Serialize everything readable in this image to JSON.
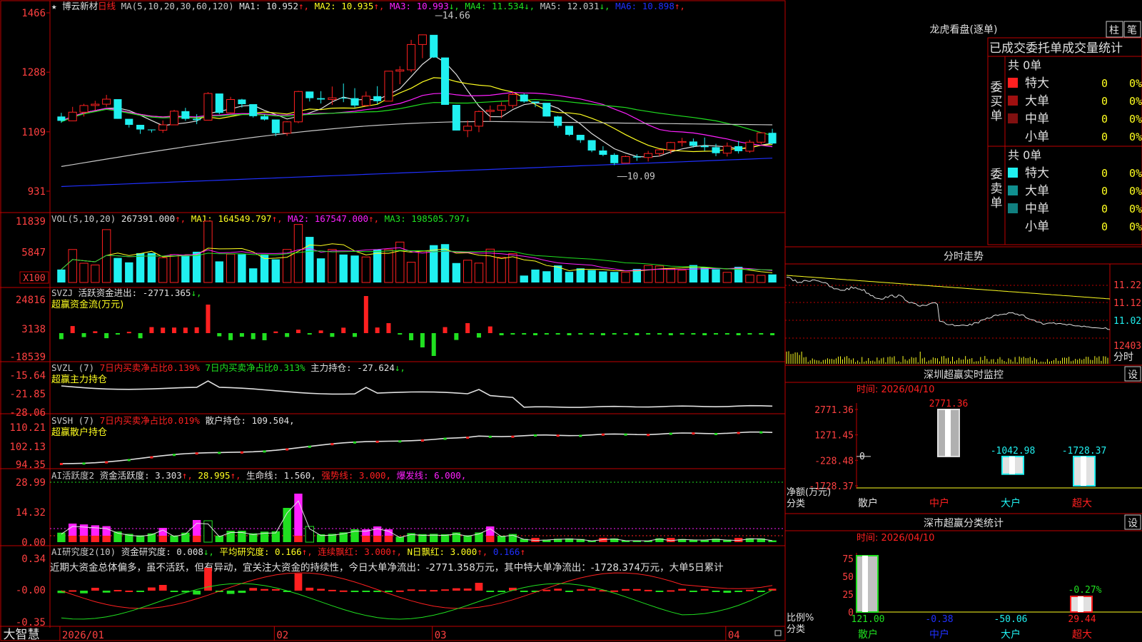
{
  "colors": {
    "up": "#ff2020",
    "down": "#20f0f0",
    "green": "#20e020",
    "magenta": "#ff20ff",
    "yellow": "#ffff20",
    "white": "#e0e0e0",
    "blue": "#2030ff",
    "grid": "#c00000",
    "axis_text": "#ff4040",
    "label": "#c8c8c8"
  },
  "header": {
    "star": "★",
    "stock_name": "博云新材",
    "period": "日线",
    "ma_spec": "MA(5,10,20,30,60,120)",
    "ma_items": [
      {
        "label": "MA1: 10.952",
        "arrow": "↑",
        "color": "#e0e0e0"
      },
      {
        "label": "MA2: 10.935",
        "arrow": "↑",
        "color": "#ffff20"
      },
      {
        "label": "MA3: 10.993",
        "arrow": "↓",
        "color": "#ff20ff"
      },
      {
        "label": "MA4: 11.534",
        "arrow": "↓",
        "color": "#20e020"
      },
      {
        "label": "MA5: 12.031",
        "arrow": "↓",
        "color": "#c8c8c8"
      },
      {
        "label": "MA6: 10.898",
        "arrow": "↑",
        "color": "#2030ff"
      }
    ]
  },
  "main_axis": {
    "ticks": [
      "1466",
      "1288",
      "1109",
      "931"
    ]
  },
  "annotations": {
    "high": "14.66",
    "low": "10.09"
  },
  "vol_panel": {
    "title": "VOL(5,10,20)",
    "value": "267391.000",
    "ma1": "MA1: 164549.797",
    "ma2": "MA2: 167547.000",
    "ma3": "MA3: 198505.797",
    "ticks": [
      "11839",
      "5847"
    ],
    "unit": "X100"
  },
  "svzj_panel": {
    "title": "SVZJ",
    "item": "活跃资金进出: -2771.365",
    "subtitle": "超赢资金流(万元)",
    "ticks": [
      "24816",
      "3138",
      "-18539"
    ]
  },
  "svzl_panel": {
    "title": "SVZL (7)",
    "item1": "7日内买卖净占比0.139%",
    "item2": "7日内买卖净占比0.313%",
    "item3": "主力持仓: -27.624",
    "subtitle": "超赢主力持仓",
    "ticks": [
      "-15.64",
      "-21.85",
      "-28.06"
    ]
  },
  "svsh_panel": {
    "title": "SVSH (7)",
    "item1": "7日内买卖净占比0.019%",
    "item2": "散户持仓: 109.504,",
    "subtitle": "超赢散户持仓",
    "ticks": [
      "110.21",
      "102.13",
      "94.35"
    ]
  },
  "ai_active_panel": {
    "title": "AI活跃度2",
    "item1": "资金活跃度: 3.303",
    "item2": "28.995",
    "item3": "生命线: 1.560,",
    "item4": "强势线: 3.000,",
    "item5": "爆发线: 6.000,",
    "ticks": [
      "28.99",
      "14.32",
      "0.00"
    ]
  },
  "ai_research_panel": {
    "title": "AI研究度2(10)",
    "item1": "资金研究度: 0.008",
    "item2": "平均研究度: 0.166",
    "item3": "连续飘红: 3.000",
    "item4": "N日飘红: 3.000",
    "item5": "0.166",
    "commentary": "近期大资金总体偏多，虽不活跃，但有异动，宜关注大资金的持续性，今日大单净流出：-2771.358万元，其中特大单净流出：-1728.374万元，大单5日累计",
    "ticks": [
      "0.34",
      "-0.00",
      "-0.35"
    ]
  },
  "date_axis": {
    "labels": [
      "2026/01",
      "02",
      "03",
      "04"
    ]
  },
  "brand": "大智慧",
  "right_panel": {
    "dragon_title": "龙虎看盘(逐单)",
    "tabs": [
      "柱",
      "笔"
    ],
    "table_title": "已成交委托单成交量统计",
    "buy_header": "共 0单",
    "buy_label": "委买单",
    "buy_rows": [
      {
        "name": "特大",
        "count": "0",
        "pct": "0%",
        "color": "#ff2020"
      },
      {
        "name": "大单",
        "count": "0",
        "pct": "0%",
        "color": "#a01010"
      },
      {
        "name": "中单",
        "count": "0",
        "pct": "0%",
        "color": "#801010"
      },
      {
        "name": "小单",
        "count": "0",
        "pct": "0%",
        "color": "#000000"
      }
    ],
    "sell_header": "共 0单",
    "sell_label": "委卖单",
    "sell_rows": [
      {
        "name": "特大",
        "count": "0",
        "pct": "0%",
        "color": "#20f0f0"
      },
      {
        "name": "大单",
        "count": "0",
        "pct": "0%",
        "color": "#108f8f"
      },
      {
        "name": "中单",
        "count": "0",
        "pct": "0%",
        "color": "#107f7f"
      },
      {
        "name": "小单",
        "count": "0",
        "pct": "0%",
        "color": "#000000"
      }
    ],
    "intraday_title": "分时走势",
    "intraday_ticks": [
      "11.22",
      "11.12",
      "11.02",
      "12403"
    ],
    "intraday_label": "分时",
    "monitor_title": "深圳超赢实时监控",
    "monitor_setting": "设",
    "monitor_time": "时间: 2026/04/10",
    "monitor_ticks": [
      "2771.36",
      "1271.45",
      "-228.48",
      "-1728.37"
    ],
    "monitor_zero": "0",
    "monitor_net_label": "净额(万元)",
    "monitor_cat_label": "分类",
    "categories": [
      "散户",
      "中户",
      "大户",
      "超大"
    ],
    "monitor_values": [
      {
        "label": "",
        "value": 0
      },
      {
        "label": "2771.36",
        "value": 2771.36
      },
      {
        "label": "-1042.98",
        "value": -1042.98
      },
      {
        "label": "-1728.37",
        "value": -1728.37
      }
    ],
    "stats_title": "深市超赢分类统计",
    "stats_setting": "设",
    "stats_time": "时间: 2026/04/10",
    "stats_ticks": [
      "75",
      "50",
      "25",
      "0"
    ],
    "stats_ratio_label": "比例%",
    "stats_cat_label": "分类",
    "stats_bar_label": "-0.27%",
    "stats_values": [
      "121.00",
      "-0.38",
      "-50.06",
      "29.44"
    ]
  },
  "chart_data": {
    "type": "candlestick",
    "x": [
      "2026/01",
      "02",
      "03",
      "04"
    ],
    "ohlc": [
      [
        11.55,
        11.66,
        11.36,
        11.42
      ],
      [
        11.42,
        11.84,
        11.42,
        11.68
      ],
      [
        11.68,
        11.93,
        11.55,
        11.88
      ],
      [
        11.88,
        12.02,
        11.74,
        11.92
      ],
      [
        11.92,
        12.2,
        11.84,
        12.07
      ],
      [
        12.07,
        12.03,
        11.48,
        11.48
      ],
      [
        11.48,
        11.38,
        11.22,
        11.3
      ],
      [
        11.3,
        11.23,
        11.03,
        11.16
      ],
      [
        11.16,
        11.14,
        11.07,
        11.14
      ],
      [
        11.14,
        11.43,
        11.06,
        11.3
      ],
      [
        11.3,
        11.75,
        11.32,
        11.71
      ],
      [
        11.71,
        11.81,
        11.42,
        11.48
      ],
      [
        11.48,
        11.62,
        11.32,
        11.44
      ],
      [
        11.44,
        12.28,
        11.44,
        12.24
      ],
      [
        12.24,
        12.06,
        11.62,
        11.66
      ],
      [
        11.66,
        12.14,
        11.62,
        12.06
      ],
      [
        12.06,
        12.08,
        11.82,
        11.92
      ],
      [
        11.92,
        11.76,
        11.52,
        11.56
      ],
      [
        11.56,
        11.61,
        11.43,
        11.46
      ],
      [
        11.46,
        11.18,
        10.96,
        11.05
      ],
      [
        11.05,
        11.41,
        10.97,
        11.39
      ],
      [
        11.39,
        12.32,
        11.35,
        12.3
      ],
      [
        12.3,
        12.28,
        12.0,
        12.1
      ],
      [
        12.1,
        12.31,
        11.94,
        12.06
      ],
      [
        12.06,
        12.45,
        11.9,
        12.11
      ],
      [
        12.11,
        12.54,
        11.98,
        12.1
      ],
      [
        12.1,
        12.4,
        11.82,
        11.88
      ],
      [
        11.88,
        12.3,
        11.85,
        12.16
      ],
      [
        12.16,
        12.46,
        11.92,
        12.01
      ],
      [
        12.01,
        12.91,
        12.03,
        12.91
      ],
      [
        12.91,
        13.06,
        12.52,
        12.95
      ],
      [
        12.95,
        13.85,
        12.88,
        13.71
      ],
      [
        13.71,
        14.01,
        13.3,
        14.0
      ],
      [
        14.0,
        13.92,
        13.31,
        13.32
      ],
      [
        13.32,
        12.88,
        11.9,
        11.9
      ],
      [
        11.9,
        11.61,
        11.13,
        11.13
      ],
      [
        11.13,
        11.43,
        10.93,
        11.26
      ],
      [
        11.26,
        11.73,
        11.08,
        11.7
      ],
      [
        11.7,
        11.88,
        11.42,
        11.74
      ],
      [
        11.74,
        11.98,
        11.5,
        11.88
      ],
      [
        11.88,
        12.3,
        11.8,
        12.21
      ],
      [
        12.21,
        12.24,
        11.96,
        12.0
      ],
      [
        12.0,
        11.98,
        11.83,
        11.96
      ],
      [
        11.96,
        11.82,
        11.55,
        11.55
      ],
      [
        11.55,
        11.57,
        11.21,
        11.27
      ],
      [
        11.27,
        11.2,
        10.96,
        11.0
      ],
      [
        11.0,
        10.98,
        10.76,
        10.84
      ],
      [
        10.84,
        10.8,
        10.48,
        10.53
      ],
      [
        10.53,
        10.66,
        10.36,
        10.4
      ],
      [
        10.4,
        10.45,
        10.09,
        10.15
      ],
      [
        10.15,
        10.38,
        10.16,
        10.35
      ],
      [
        10.35,
        10.42,
        10.22,
        10.32
      ],
      [
        10.32,
        10.52,
        10.2,
        10.44
      ],
      [
        10.44,
        10.58,
        10.35,
        10.55
      ],
      [
        10.55,
        10.79,
        10.43,
        10.77
      ],
      [
        10.77,
        10.91,
        10.65,
        10.8
      ],
      [
        10.8,
        10.89,
        10.62,
        10.67
      ],
      [
        10.67,
        10.92,
        10.52,
        10.63
      ],
      [
        10.63,
        10.73,
        10.36,
        10.45
      ],
      [
        10.45,
        10.77,
        10.35,
        10.66
      ],
      [
        10.66,
        10.82,
        10.44,
        10.51
      ],
      [
        10.51,
        10.85,
        10.46,
        10.78
      ],
      [
        10.78,
        11.08,
        10.72,
        11.06
      ],
      [
        11.06,
        11.18,
        10.71,
        10.74
      ]
    ],
    "yrange": [
      9.31,
      14.66
    ],
    "vol_ylim": [
      0,
      11839
    ],
    "vol_ticks": [
      11839,
      5847
    ]
  }
}
